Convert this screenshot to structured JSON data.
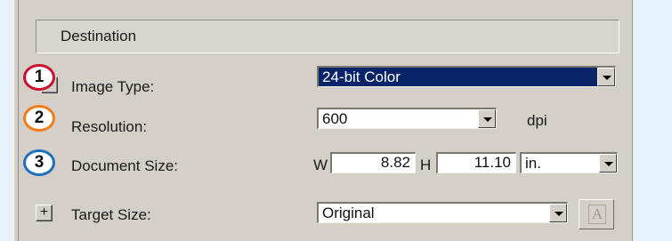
{
  "section": {
    "title": "Destination"
  },
  "rows": {
    "image_type": {
      "label": "Image Type:",
      "value": "24-bit Color"
    },
    "resolution": {
      "label": "Resolution:",
      "value": "600",
      "unit": "dpi"
    },
    "document_size": {
      "label": "Document Size:",
      "width_label": "W",
      "width_value": "8.82",
      "height_label": "H",
      "height_value": "11.10",
      "unit_value": "in."
    },
    "target_size": {
      "label": "Target Size:",
      "value": "Original",
      "plus": "+"
    }
  },
  "badges": [
    {
      "number": "1",
      "color": "#c8102e"
    },
    {
      "number": "2",
      "color": "#f07d1a"
    },
    {
      "number": "3",
      "color": "#1e6fc0"
    }
  ],
  "font_button": {
    "glyph": "A"
  }
}
